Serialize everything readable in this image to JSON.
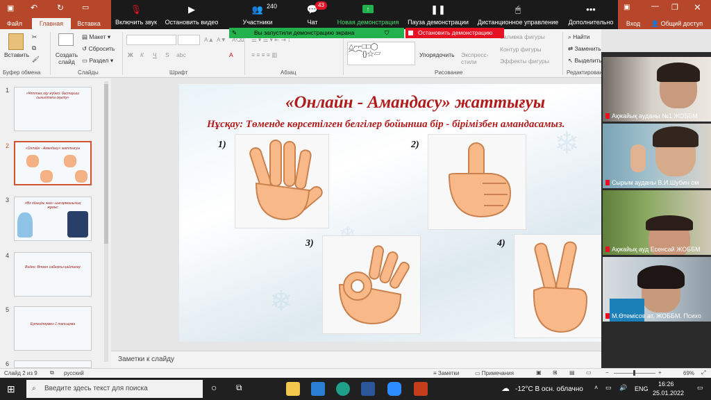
{
  "titlebar": {
    "login": "Вход",
    "share": "Общий доступ"
  },
  "tabs": [
    "Файл",
    "Главная",
    "Вставка"
  ],
  "zoom": {
    "mute": "Включить звук",
    "stop_video": "Остановить видео",
    "participants": "Участники",
    "participants_count": "240",
    "chat": "Чат",
    "chat_badge": "43",
    "new_share": "Новая демонстрация",
    "pause_share": "Пауза демонстрации",
    "remote": "Дистанционное управление",
    "more": "Дополнительно",
    "sharing_notice": "Вы запустили демонстрацию экрана",
    "stop_share": "Остановить демонстрацию"
  },
  "ribbon": {
    "paste": "Вставить",
    "clipboard": "Буфер обмена",
    "new_slide": "Создать слайд",
    "layout": "Макет",
    "reset": "Сбросить",
    "section": "Раздел",
    "slides": "Слайды",
    "font": "Шрифт",
    "bold": "Ж",
    "italic": "К",
    "underline": "Ч",
    "strike": "S",
    "shadow": "abc",
    "paragraph": "Абзац",
    "arrange": "Упорядочить",
    "express_styles": "Экспресс-стили",
    "fill": "Заливка фигуры",
    "outline": "Контур фигуры",
    "effects": "Эффекты фигуры",
    "drawing": "Рисование",
    "find": "Найти",
    "replace": "Заменить",
    "select": "Выделить",
    "editing": "Редактирование"
  },
  "thumbs": [
    {
      "num": "1",
      "text": "«Ұлттық оқу жүйесі: бастауыш сыныптағы оқыту»"
    },
    {
      "num": "2",
      "text": "«Онлайн - Амандасу» жаттығуы"
    },
    {
      "num": "3",
      "text": "«Өз ойыңды жаз» шығармашылық жұмыс"
    },
    {
      "num": "4",
      "text": "Видео: Өткен сабақты қайталау"
    },
    {
      "num": "5",
      "text": "Ертегілермен 1 тапсырма"
    },
    {
      "num": "6",
      "text": ""
    }
  ],
  "slide": {
    "title": "«Онлайн - Амандасу» жаттығуы",
    "subtitle": "Нұсқау: Төменде көрсетілген белгілер бойынша бір - бірімізбен амандасамыз.",
    "labels": [
      "1)",
      "2)",
      "3)",
      "4)"
    ]
  },
  "notes": "Заметки к слайду",
  "videos": [
    "Ақжайық ауданы №1 ЖОББМ",
    "Сырым ауданы В.И.Шубин ом",
    "Ақжайық ауд Есенсай ЖОББМ",
    "М.Өтемісов ат. ЖОББМ. Психо"
  ],
  "status": {
    "slide": "Слайд 2 из 9",
    "lang": "русский",
    "notes": "Заметки",
    "comments": "Примечания",
    "zoom": "69%"
  },
  "taskbar": {
    "search_placeholder": "Введите здесь текст для поиска",
    "weather": "-12°C  В осн. облачно",
    "lang": "ENG",
    "time": "16:26",
    "date": "25.01.2022"
  }
}
